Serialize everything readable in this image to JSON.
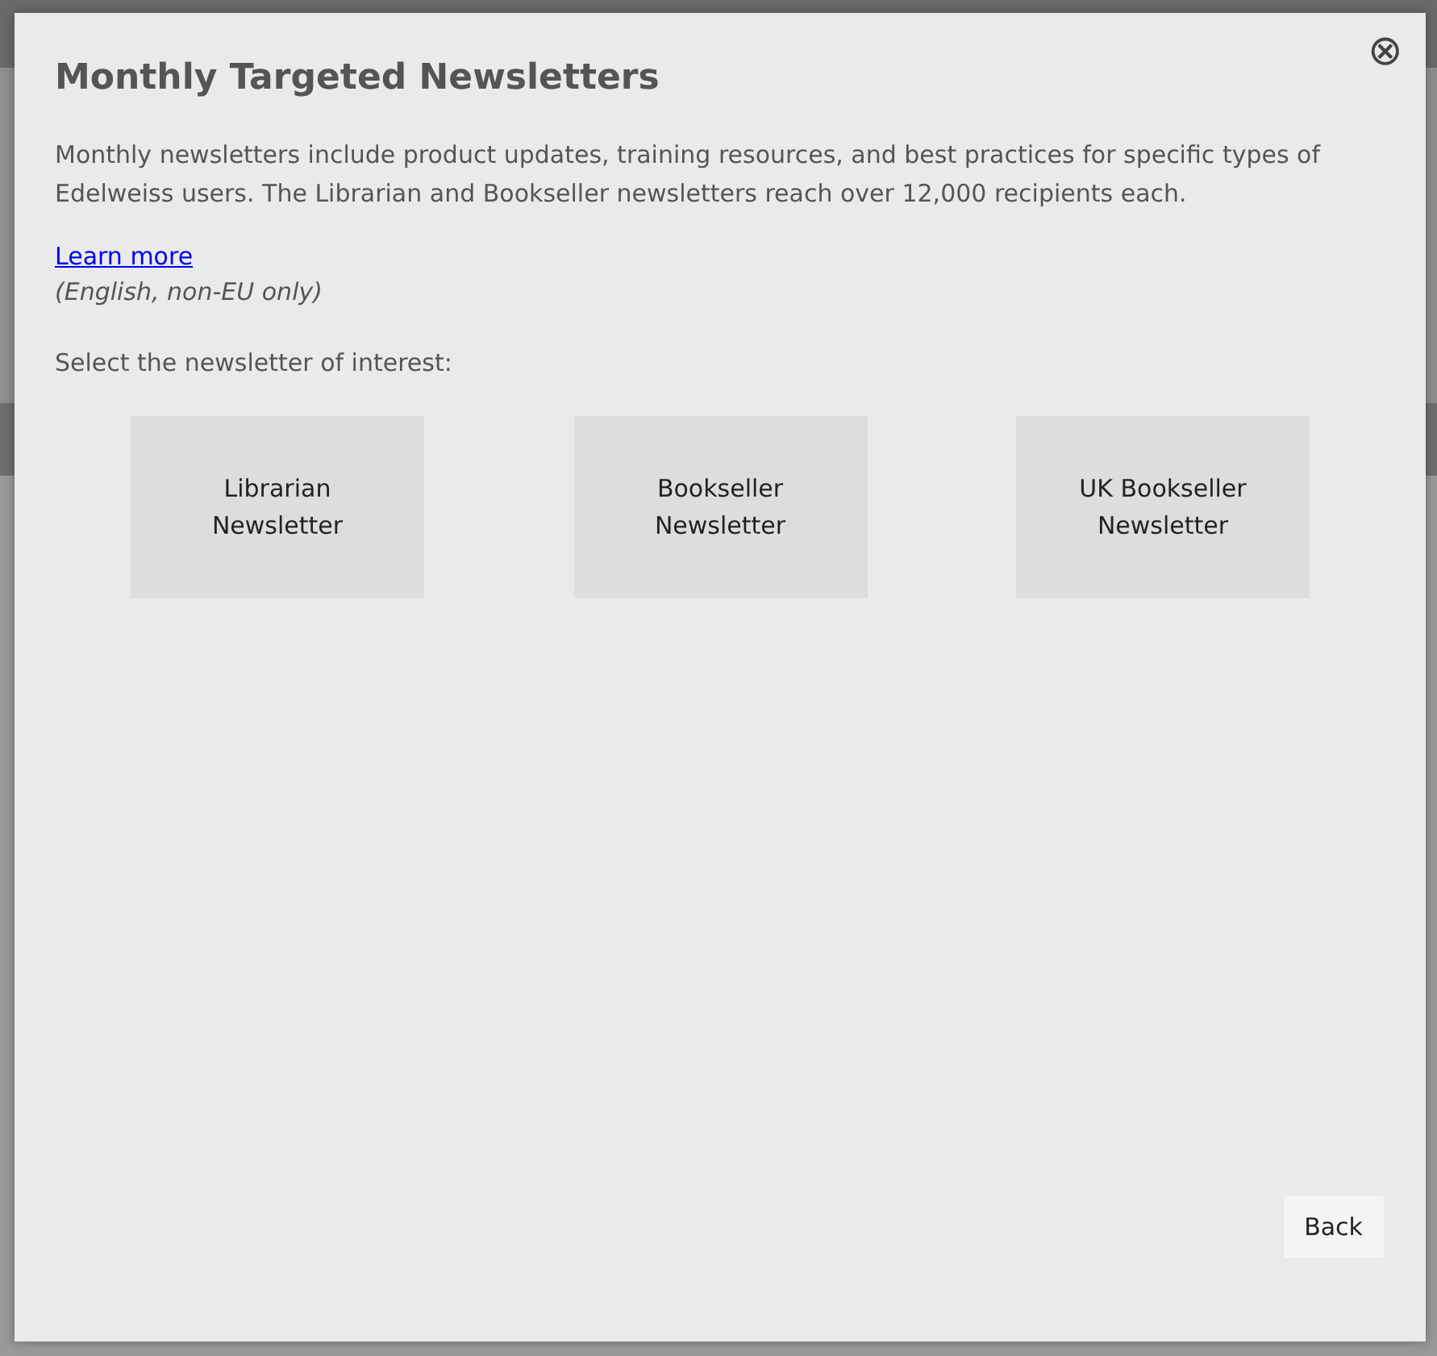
{
  "dialog": {
    "title": "Monthly Targeted Newsletters",
    "close_icon": "⊗",
    "description": "Monthly newsletters include product updates, training resources, and best practices for specific types of Edelweiss users. The Librarian and Bookseller newsletters reach over 12,000 recipients each.",
    "link": "Learn more",
    "note": "(English, non-EU only)",
    "prompt": "Select the newsletter of interest:",
    "options": [
      {
        "label": "Librarian Newsletter"
      },
      {
        "label": "Bookseller Newsletter"
      },
      {
        "label": "UK Bookseller Newsletter"
      }
    ],
    "back_button": "Back"
  }
}
